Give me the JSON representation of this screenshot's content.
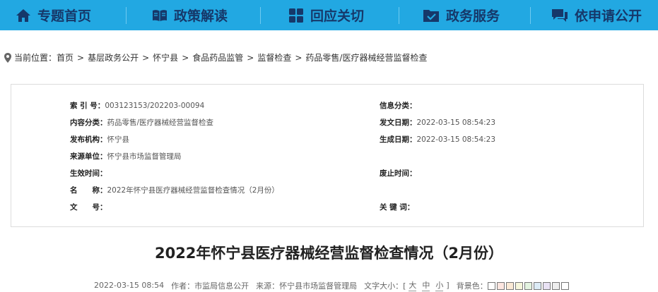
{
  "nav": {
    "items": [
      {
        "label": "专题首页",
        "icon": "home-icon"
      },
      {
        "label": "政策解读",
        "icon": "book-icon"
      },
      {
        "label": "回应关切",
        "icon": "grid-icon"
      },
      {
        "label": "政务服务",
        "icon": "folder-check-icon"
      },
      {
        "label": "依申请公开",
        "icon": "chat-icon"
      }
    ]
  },
  "breadcrumb": {
    "prefix": "当前位置：",
    "items": [
      "首页",
      "基层政务公开",
      "怀宁县",
      "食品药品监管",
      "监督检查",
      "药品零售/医疗器械经营监督检查"
    ],
    "separator": ">"
  },
  "info": {
    "index_no": {
      "label": "索 引 号：",
      "value": "003123153/202203-00094"
    },
    "category": {
      "label": "信息分类：",
      "value": ""
    },
    "content_type": {
      "label": "内容分类：",
      "value": "药品零售/医疗器械经营监督检查"
    },
    "issue_date": {
      "label": "发文日期：",
      "value": "2022-03-15 08:54:23"
    },
    "publisher": {
      "label": "发布机构：",
      "value": "怀宁县"
    },
    "gen_date": {
      "label": "生成日期：",
      "value": "2022-03-15 08:54:23"
    },
    "source": {
      "label": "来源单位：",
      "value": "怀宁县市场监督管理局"
    },
    "effective": {
      "label": "生效时间：",
      "value": ""
    },
    "expire": {
      "label": "废止时间：",
      "value": ""
    },
    "name": {
      "label": "名　　称：",
      "value": "2022年怀宁县医疗器械经营监督检查情况（2月份）"
    },
    "doc_no": {
      "label": "文　　号：",
      "value": ""
    },
    "keywords": {
      "label": "关 键 词：",
      "value": ""
    }
  },
  "article": {
    "title": "2022年怀宁县医疗器械经营监督检查情况（2月份）",
    "date": "2022-03-15 08:54",
    "author": "作者：市监局信息公开",
    "source": "来源：怀宁县市场监督管理局",
    "font_label": "文字大小：[",
    "font_sizes": [
      "大",
      "中",
      "小"
    ],
    "font_close": "]",
    "bg_label": "背景色："
  },
  "bg_colors": [
    "#ffffff",
    "#fde6e0",
    "#fae9d5",
    "#f6f6dc",
    "#e3f3e0",
    "#dcebf6",
    "#e9e2f4",
    "#eeeeee",
    "#ffffff"
  ],
  "colors": {
    "nav_bg": "#22a8e2",
    "nav_text": "#16386a"
  }
}
